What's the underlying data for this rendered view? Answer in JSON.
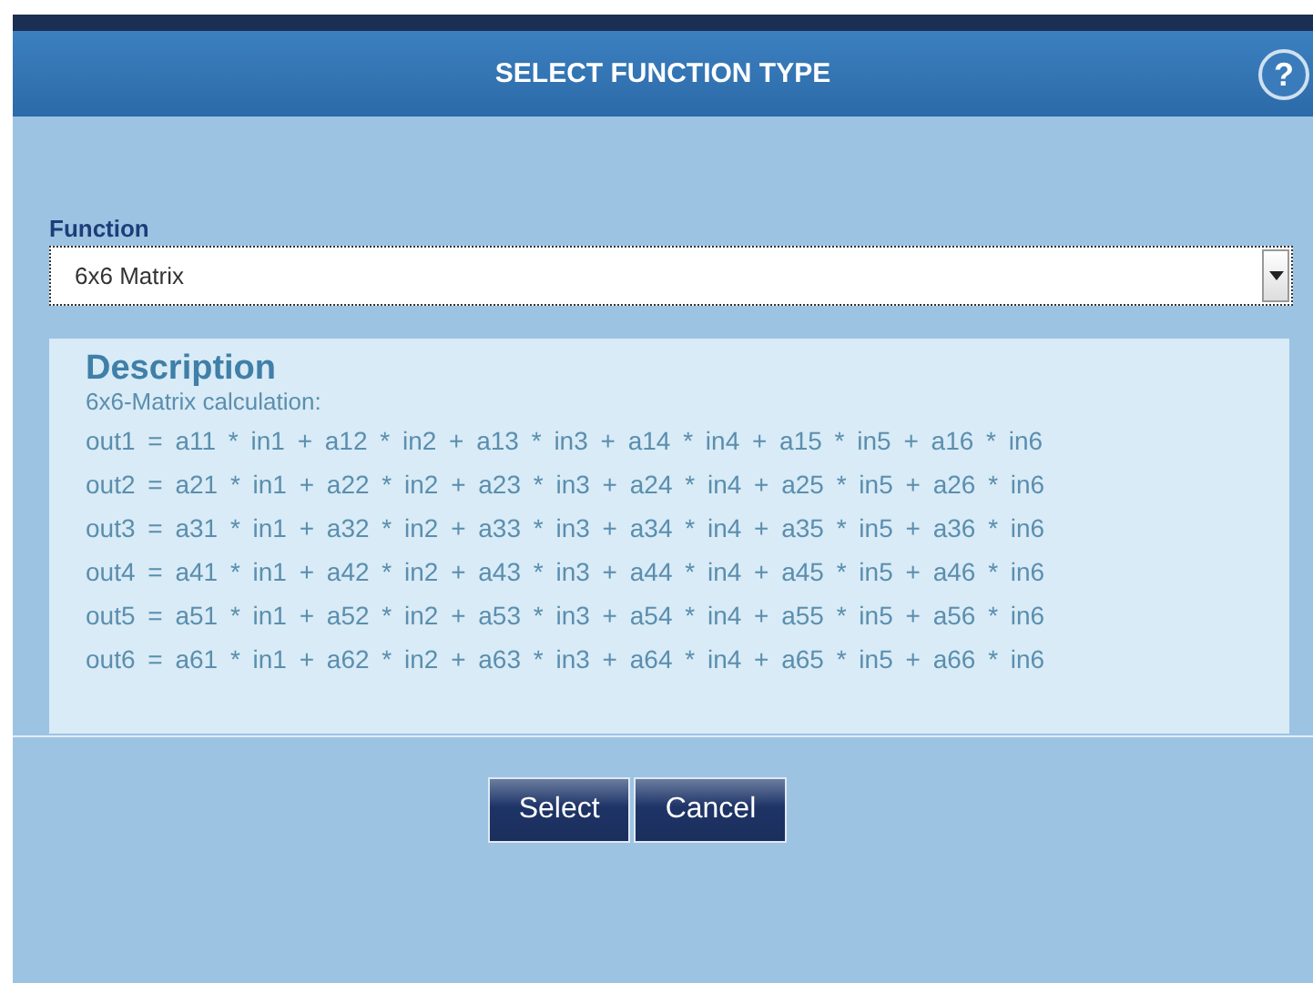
{
  "dialog": {
    "title": "SELECT FUNCTION TYPE",
    "help": "?"
  },
  "function_field": {
    "label": "Function",
    "value": "6x6 Matrix"
  },
  "description": {
    "heading": "Description",
    "lines": [
      "6x6-Matrix calculation:",
      "out1 = a11 * in1 + a12 * in2 + a13 * in3 + a14 * in4 + a15 * in5 + a16 * in6",
      "out2 = a21 * in1 + a22 * in2 + a23 * in3 + a24 * in4 + a25 * in5 + a26 * in6",
      "out3 = a31 * in1 + a32 * in2 + a33 * in3 + a34 * in4 + a35 * in5 + a36 * in6",
      "out4 = a41 * in1 + a42 * in2 + a43 * in3 + a44 * in4 + a45 * in5 + a46 * in6",
      "out5 = a51 * in1 + a52 * in2 + a53 * in3 + a54 * in4 + a55 * in5 + a56 * in6",
      "out6 = a61 * in1 + a62 * in2 + a63 * in3 + a64 * in4 + a65 * in5 + a66 * in6"
    ]
  },
  "buttons": [
    "Select",
    "Cancel"
  ]
}
